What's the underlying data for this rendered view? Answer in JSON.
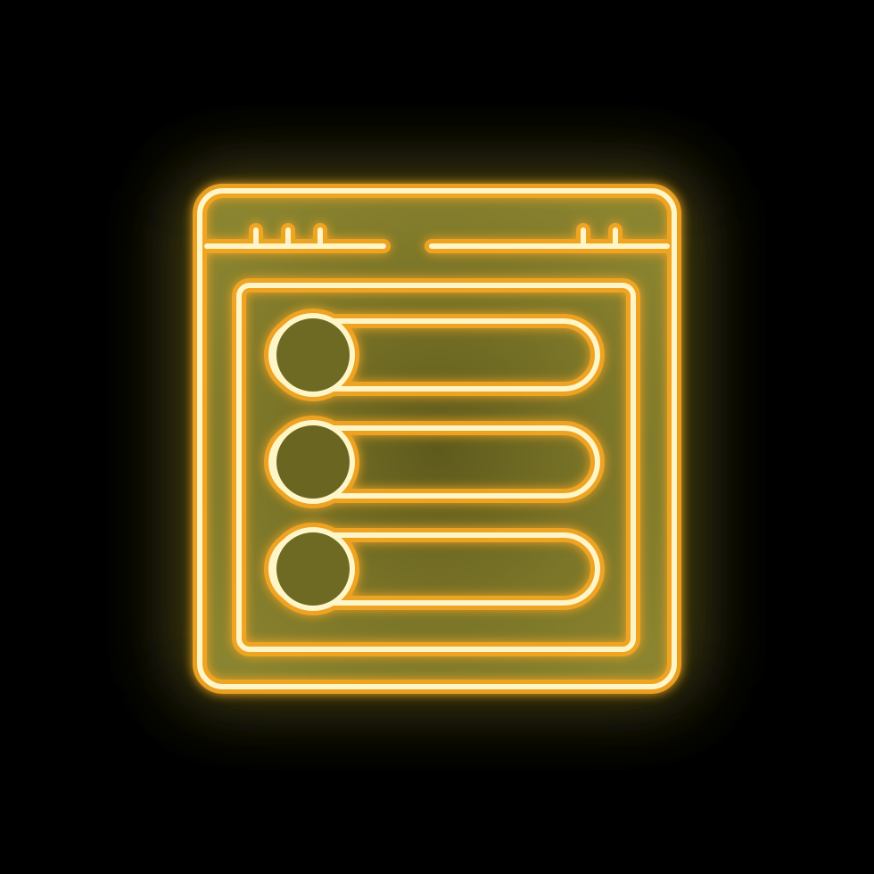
{
  "icon": {
    "name": "browser-list-window-icon",
    "style": "neon-outline",
    "colors": {
      "background": "#000000",
      "glow_inner": "#7a7428",
      "glow_outer": "#4a4a10",
      "stroke_outer": "#f5a623",
      "stroke_core": "#fff6c8"
    },
    "window_controls_left": [
      "dot",
      "dot",
      "dot"
    ],
    "window_controls_right": [
      "dot",
      "dot"
    ],
    "list_items": [
      {
        "name": "list-item-1"
      },
      {
        "name": "list-item-2"
      },
      {
        "name": "list-item-3"
      }
    ]
  }
}
